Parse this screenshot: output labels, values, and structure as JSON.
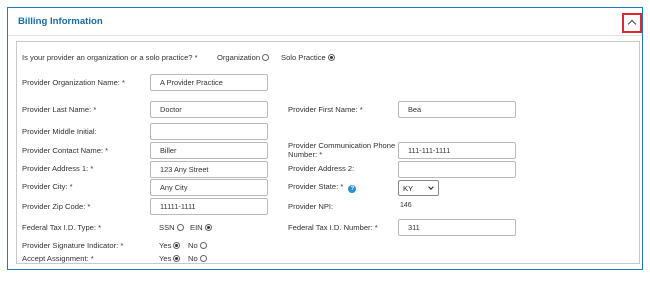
{
  "section": {
    "title": "Billing Information",
    "collapse_icon": "chevron-up-icon"
  },
  "provider_type": {
    "question": "Is your provider an organization or a solo practice? *",
    "options": [
      {
        "label": "Organization",
        "selected": false
      },
      {
        "label": "Solo Practice",
        "selected": true
      }
    ]
  },
  "fields": {
    "org_name": {
      "label": "Provider Organization Name: *",
      "value": "A Provider Practice"
    },
    "last_name": {
      "label": "Provider Last Name: *",
      "value": "Doctor"
    },
    "first_name": {
      "label": "Provider First Name: *",
      "value": "Bea"
    },
    "middle_initial": {
      "label": "Provider Middle Initial:",
      "value": ""
    },
    "contact_name": {
      "label": "Provider Contact Name: *",
      "value": "Biller"
    },
    "phone_label_line1": "Provider Communication Phone",
    "phone_label_line2": "Number: *",
    "phone": {
      "value": "111-111-1111"
    },
    "address1": {
      "label": "Provider Address 1: *",
      "value": "123 Any Street"
    },
    "address2": {
      "label": "Provider Address 2:",
      "value": ""
    },
    "city": {
      "label": "Provider City: *",
      "value": "Any City"
    },
    "state": {
      "label": "Provider State: *",
      "value": "KY",
      "help_icon": "help-icon"
    },
    "zip": {
      "label": "Provider Zip Code: *",
      "value": "11111-1111"
    },
    "npi": {
      "label": "Provider NPI:",
      "value": "146"
    },
    "tax_type": {
      "label": "Federal Tax I.D. Type: *",
      "options": [
        {
          "label": "SSN",
          "selected": false
        },
        {
          "label": "EIN",
          "selected": true
        }
      ]
    },
    "tax_number": {
      "label": "Federal Tax I.D. Number: *",
      "value": "311"
    },
    "signature": {
      "label": "Provider Signature Indicator: *",
      "options": [
        {
          "label": "Yes",
          "selected": true
        },
        {
          "label": "No",
          "selected": false
        }
      ]
    },
    "accept": {
      "label": "Accept Assignment: *",
      "options": [
        {
          "label": "Yes",
          "selected": true
        },
        {
          "label": "No",
          "selected": false
        }
      ]
    }
  }
}
